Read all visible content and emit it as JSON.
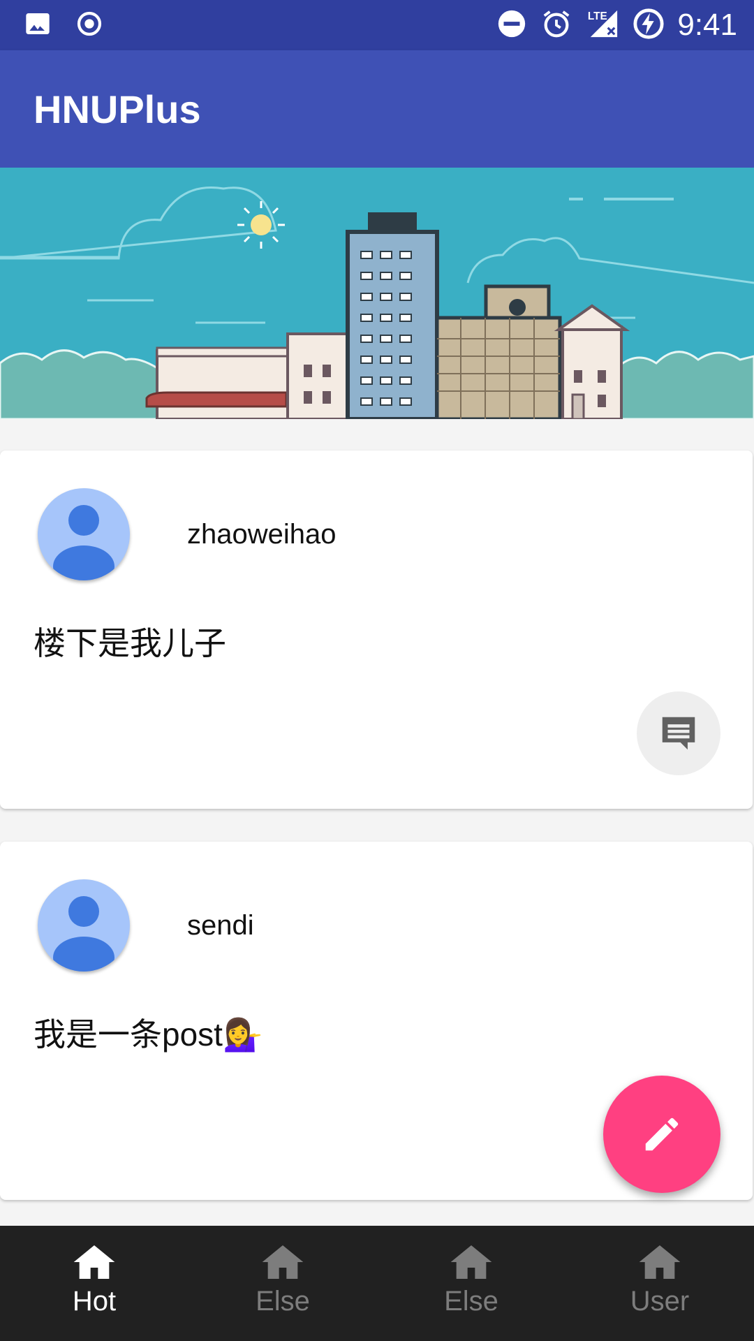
{
  "status_bar": {
    "time": "9:41",
    "left_icons": [
      "image-icon",
      "record-icon"
    ],
    "right_icons": [
      "do-not-disturb-icon",
      "alarm-icon",
      "lte-signal-icon",
      "battery-charging-icon"
    ]
  },
  "app_bar": {
    "title": "HNUPlus"
  },
  "banner": {
    "description_icon": "city-skyline-illustration"
  },
  "posts": [
    {
      "username": "zhaoweihao",
      "text": "楼下是我儿子",
      "action_icon": "comment-icon"
    },
    {
      "username": "sendi",
      "text": "我是一条post💁‍♀️"
    }
  ],
  "fab": {
    "icon": "edit-pencil-icon"
  },
  "bottom_nav": {
    "items": [
      {
        "label": "Hot",
        "icon": "home-icon",
        "active": true
      },
      {
        "label": "Else",
        "icon": "home-icon",
        "active": false
      },
      {
        "label": "Else",
        "icon": "home-icon",
        "active": false
      },
      {
        "label": "User",
        "icon": "home-icon",
        "active": false
      }
    ]
  },
  "colors": {
    "status_bar": "#303f9f",
    "app_bar": "#3f51b5",
    "fab": "#ff4081",
    "bottom_nav": "#212121",
    "avatar": "#a6c5fa"
  }
}
